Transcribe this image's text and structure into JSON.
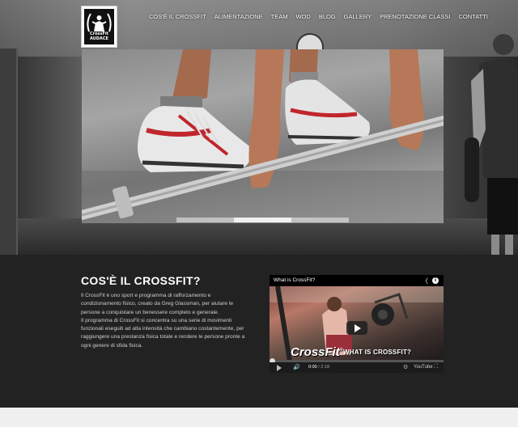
{
  "brand": {
    "logo_line1": "CrossFit",
    "logo_line2": "AUDACE"
  },
  "nav": {
    "items": [
      {
        "label": "COS'È IL CROSSFIT"
      },
      {
        "label": "ALIMENTAZIONE"
      },
      {
        "label": "TEAM"
      },
      {
        "label": "WOD"
      },
      {
        "label": "BLOG"
      },
      {
        "label": "GALLERY"
      },
      {
        "label": "PRENOTAZIONE CLASSI"
      },
      {
        "label": "CONTATTI"
      }
    ]
  },
  "slider": {
    "slide_count": 3,
    "active_index": 1
  },
  "about": {
    "title": "COS'È IL CROSSFIT?",
    "paragraph1": "Il CrossFit è uno sport e programma di rafforzamento e condizionamento fisico, creato da Greg Glassman, per aiutare le persone a conquistare un benessere completo e generale.",
    "paragraph2": "Il programma di CrossFit si concentra su una serie di movimenti funzionali eseguiti ad alta intensità che cambiano costantemente, per raggiungere una prestanza fisica totale e rendere le persone pronte a ogni genere di sfida fisica."
  },
  "video": {
    "title": "What is CrossFit?",
    "overlay_brand": "CrossFit",
    "overlay_brand_mark": "®",
    "overlay_caption": "WHAT IS CROSSFIT?",
    "current_time": "0:00",
    "duration": "/ 2:18",
    "youtube_label": "YouTube",
    "progress": 0
  },
  "colors": {
    "content_bg": "#222222",
    "footer_bg": "#f0f0f0",
    "shoe_accent": "#d0282e"
  }
}
